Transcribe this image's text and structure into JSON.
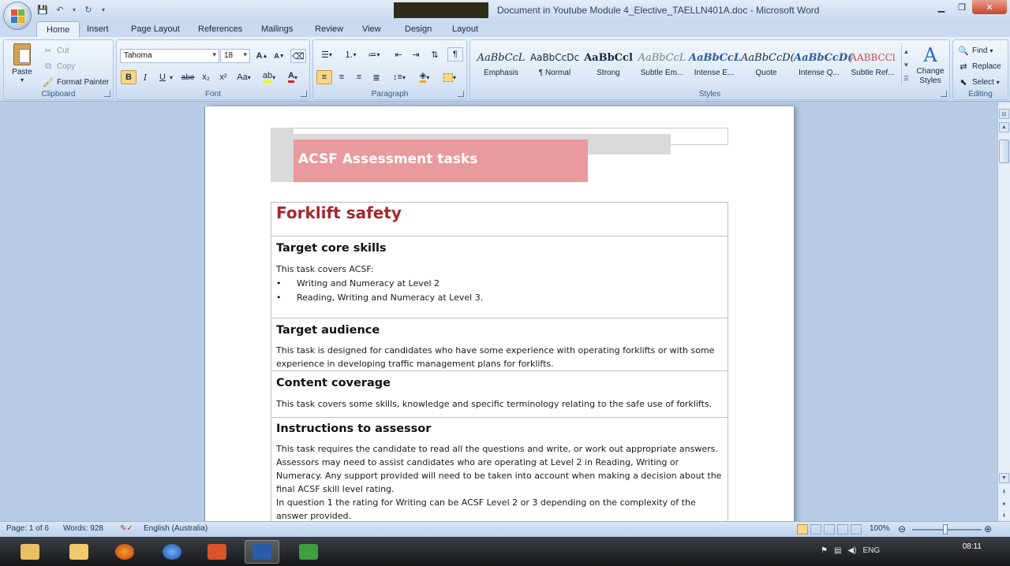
{
  "window": {
    "title": "Document in Youtube Module 4_Elective_TAELLN401A.doc - Microsoft Word"
  },
  "tabs": [
    "Home",
    "Insert",
    "Page Layout",
    "References",
    "Mailings",
    "Review",
    "View",
    "Design",
    "Layout"
  ],
  "ribbon": {
    "clipboard": {
      "label": "Clipboard",
      "paste": "Paste",
      "cut": "Cut",
      "copy": "Copy",
      "format_painter": "Format Painter"
    },
    "font": {
      "label": "Font",
      "font_name": "Tahoma",
      "font_size": "18",
      "bold": "B",
      "italic": "I",
      "underline": "U",
      "strike": "abe",
      "subscript": "x₂",
      "superscript": "x²",
      "change_case": "Aa",
      "grow": "A",
      "shrink": "A"
    },
    "paragraph": {
      "label": "Paragraph"
    },
    "styles": {
      "label": "Styles",
      "items": [
        {
          "preview": "AaBbCcL",
          "name": "Emphasis"
        },
        {
          "preview": "AaBbCcDc",
          "name": "¶ Normal"
        },
        {
          "preview": "AaBbCcl",
          "name": "Strong"
        },
        {
          "preview": "AaBbCcL",
          "name": "Subtle Em..."
        },
        {
          "preview": "AaBbCcL",
          "name": "Intense E..."
        },
        {
          "preview": "AaBbCcD(",
          "name": "Quote"
        },
        {
          "preview": "AaBbCcD(",
          "name": "Intense Q..."
        },
        {
          "preview": "AABBCCl",
          "name": "Subtle Ref..."
        }
      ],
      "change_styles": "Change Styles"
    },
    "editing": {
      "label": "Editing",
      "find": "Find",
      "replace": "Replace",
      "select": "Select"
    }
  },
  "document": {
    "banner_title": "ACSF Assessment  tasks",
    "task_title": "Forklift safety",
    "sections": [
      {
        "heading": "Target core skills",
        "intro": "This task covers ACSF:",
        "bullets": [
          "Writing and Numeracy at Level 2",
          "Reading, Writing and Numeracy at Level 3."
        ]
      },
      {
        "heading": "Target audience",
        "text": "This task is designed for candidates who have some experience with operating forklifts or with some experience in developing traffic management plans for forklifts."
      },
      {
        "heading": "Content coverage",
        "text": "This task covers some skills, knowledge and specific terminology relating to the safe use of forklifts."
      },
      {
        "heading": "Instructions to assessor",
        "text": "This task requires the candidate to read all the questions and write, or work out appropriate answers. Assessors may need to assist candidates who are operating at Level 2 in Reading, Writing or Numeracy. Any support provided will need to be taken into account when making a decision about the final ACSF skill level rating.",
        "text2": "In question 1 the rating for Writing can be ACSF Level 2 or 3 depending on the complexity of the answer provided."
      }
    ]
  },
  "status": {
    "page": "Page: 1 of 6",
    "words": "Words: 928",
    "language": "English (Australia)",
    "zoom": "100%"
  },
  "taskbar": {
    "lang": "ENG",
    "time": "08:11"
  },
  "colors": {
    "banner_bg": "#e89a9c",
    "title_red": "#a3282e"
  }
}
